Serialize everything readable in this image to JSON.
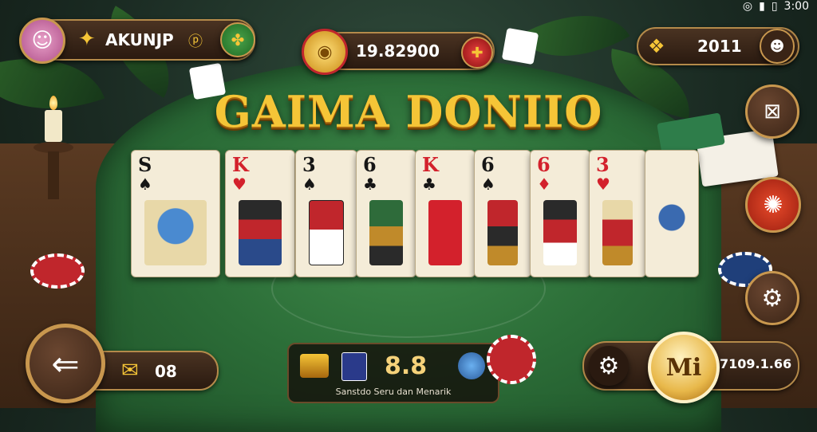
{
  "status_bar": {
    "time": "3:00",
    "wifi_icon": "wifi-icon",
    "signal_icon": "signal-icon",
    "battery_icon": "battery-icon"
  },
  "player": {
    "name": "AKUNJP",
    "level_icon": "gold-star-icon"
  },
  "coins": {
    "value": "19.82900"
  },
  "gems": {
    "value": "2011"
  },
  "game_title": "GAIMA DONIIO",
  "cards": [
    {
      "rank": "S",
      "pip": "♠",
      "color": "black"
    },
    {
      "rank": "K",
      "pip": "♥",
      "color": "red"
    },
    {
      "rank": "3",
      "pip": "♠",
      "color": "black"
    },
    {
      "rank": "6",
      "pip": "♣",
      "color": "black"
    },
    {
      "rank": "K",
      "pip": "♣",
      "color": "red"
    },
    {
      "rank": "6",
      "pip": "♠",
      "color": "black"
    },
    {
      "rank": "6",
      "pip": "♦",
      "color": "red"
    },
    {
      "rank": "3",
      "pip": "♥",
      "color": "red"
    },
    {
      "rank": "",
      "pip": "",
      "color": "black"
    }
  ],
  "mail": {
    "count": "08"
  },
  "center_panel": {
    "value": "8.8",
    "caption": "Sanstdo Seru dan Menarik"
  },
  "bottom_right": {
    "badge_label": "Mi",
    "value": "7109.1.66"
  }
}
